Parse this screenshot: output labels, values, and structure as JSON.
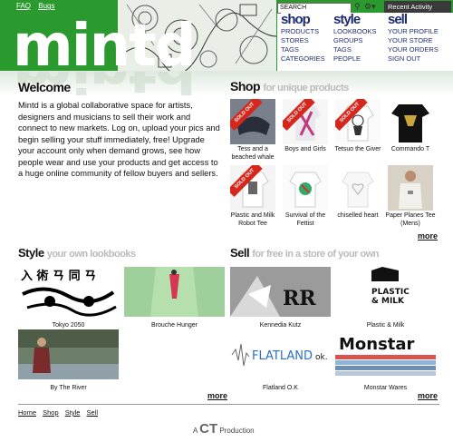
{
  "header": {
    "logo": "mintd",
    "links": [
      "FAQ",
      "Bugs"
    ],
    "search_placeholder": "SEARCH",
    "recent_activity": "Recent Activity",
    "nav": [
      {
        "title": "shop",
        "items": [
          "PRODUCTS",
          "STORES",
          "TAGS",
          "CATEGORIES"
        ]
      },
      {
        "title": "style",
        "items": [
          "LOOKBOOKS",
          "GROUPS",
          "TAGS",
          "PEOPLE"
        ]
      },
      {
        "title": "sell",
        "items": [
          "YOUR PROFILE",
          "YOUR STORE",
          "YOUR ORDERS",
          "SIGN OUT"
        ]
      }
    ]
  },
  "welcome": {
    "title": "Welcome",
    "body": "Mintd is a global collaborative space for artists, designers and musicians to sell their work and connect to new markets. Log on, upload your pics and begin selling your stuff immediately, free! Upgrade your account only when demand grows, see how people wear and use your products and get access to a huge online community of fellow buyers and sellers."
  },
  "shop": {
    "title": "Shop",
    "subtitle": "for unique products",
    "sold_out_label": "SOLD OUT",
    "products": [
      {
        "name": "Tess and a beached whale",
        "sold_out": true
      },
      {
        "name": "Boys and Girls",
        "sold_out": true
      },
      {
        "name": "Tetsuo the Giver",
        "sold_out": true
      },
      {
        "name": "Commando T",
        "sold_out": false
      },
      {
        "name": "Plastic and Milk Robot Tee",
        "sold_out": true
      },
      {
        "name": "Survival of the Fettist",
        "sold_out": false
      },
      {
        "name": "chiselled heart",
        "sold_out": false
      },
      {
        "name": "Paper Planes Tee (Mens)",
        "sold_out": false
      }
    ],
    "more": "more"
  },
  "style": {
    "title": "Style",
    "subtitle": "your own lookbooks",
    "lookbooks": [
      "Tokyo 2050",
      "Brouche Hunger",
      "By The River"
    ],
    "more": "more"
  },
  "sell": {
    "title": "Sell",
    "subtitle": "for free in a store of your own",
    "stores": [
      "Kennedia Kutz",
      "Plastic & Milk",
      "Flatland O.K",
      "Monstar Wares"
    ],
    "more": "more"
  },
  "footer": {
    "links": [
      "Home",
      "Shop",
      "Style",
      "Sell"
    ],
    "credit_pre": "A",
    "credit_logo": "CT",
    "credit_post": "Production"
  }
}
